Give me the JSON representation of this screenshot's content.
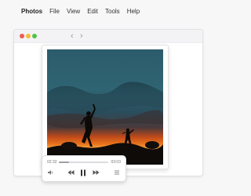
{
  "menubar": {
    "app_name": "Photos",
    "items": [
      "File",
      "View",
      "Edit",
      "Tools",
      "Help"
    ]
  },
  "window": {
    "buttons": {
      "close": "close",
      "minimize": "minimize",
      "zoom": "zoom"
    },
    "nav": {
      "back": "‹",
      "forward": "›"
    }
  },
  "photo": {
    "icon": "photo-thumbnail"
  },
  "player": {
    "time_current": "02:32",
    "time_total": "03:03",
    "progress": 0.2,
    "controls": [
      "volume-icon",
      "rewind-icon",
      "pause-icon",
      "fast-forward-icon",
      "playlist-icon"
    ]
  }
}
